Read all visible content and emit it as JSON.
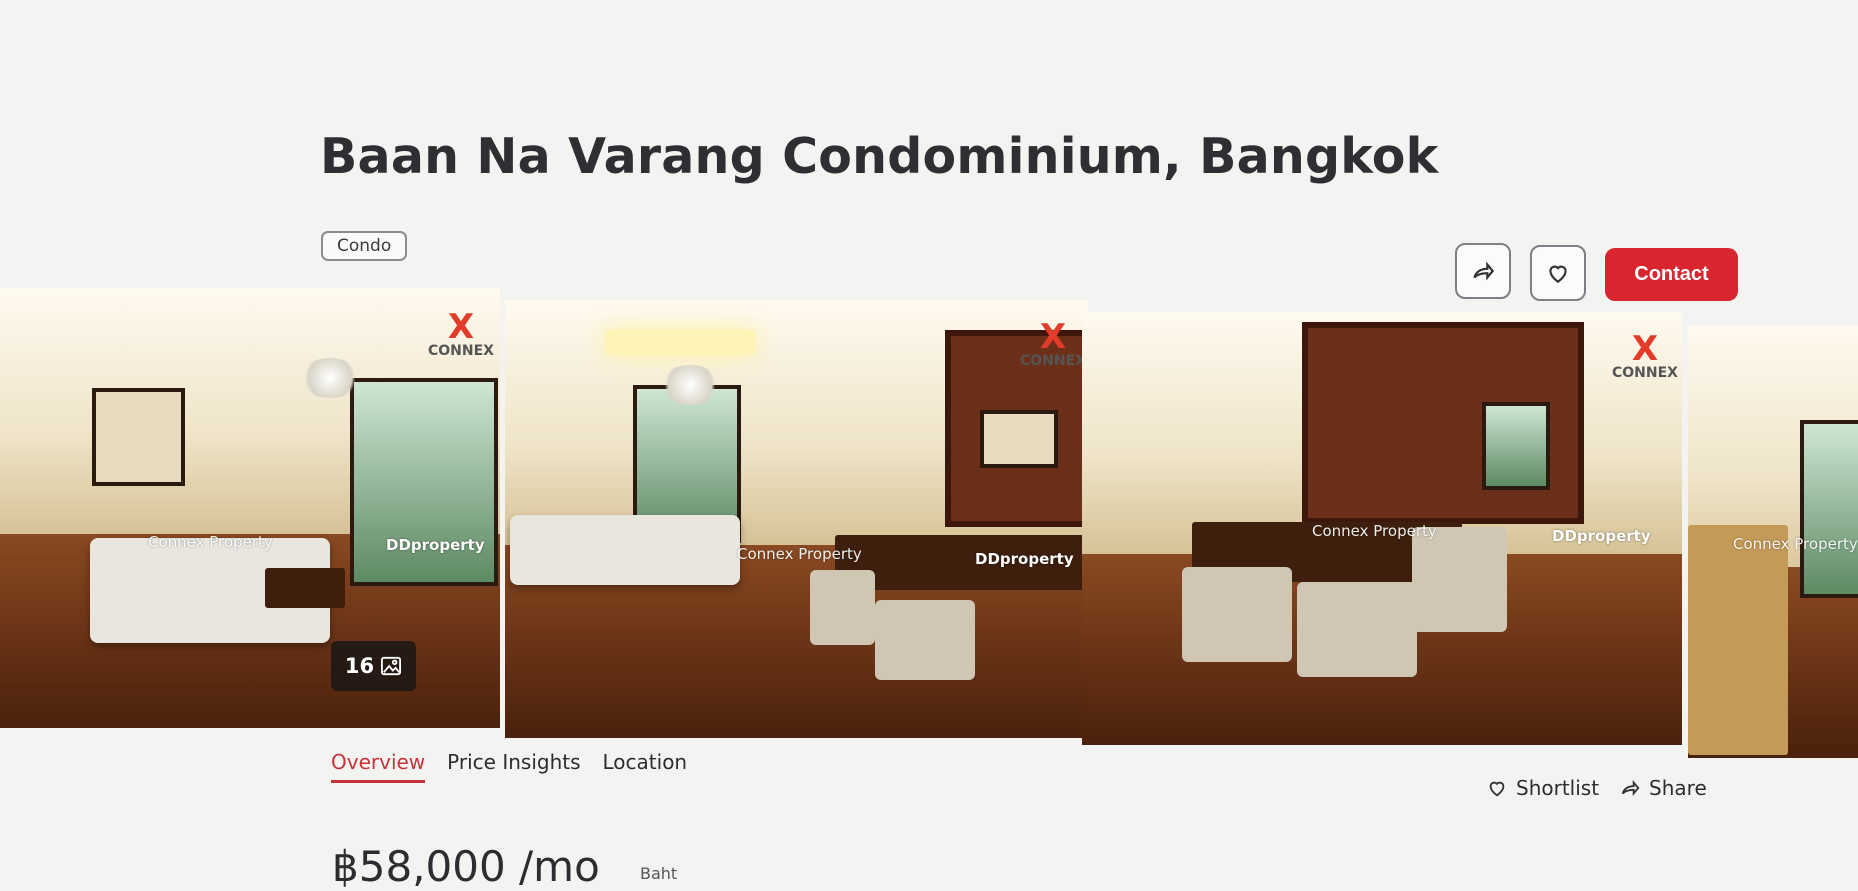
{
  "listing": {
    "title": "Baan Na Varang Condominium, Bangkok",
    "tag": "Condo"
  },
  "header_actions": {
    "share_icon": "share-arrow-icon",
    "favorite_icon": "heart-icon",
    "contact_label": "Contact",
    "accent_color": "#d9252e"
  },
  "gallery": {
    "photo_count": "16",
    "watermarks": {
      "agency": "Connex Property",
      "portal": "DDproperty",
      "logo_text": "CONNEX"
    }
  },
  "tabs": [
    {
      "label": "Overview",
      "active": true
    },
    {
      "label": "Price Insights",
      "active": false
    },
    {
      "label": "Location",
      "active": false
    }
  ],
  "page_actions": {
    "shortlist_label": "Shortlist",
    "share_label": "Share"
  },
  "pricing": {
    "price": "฿58,000 /mo",
    "currency_label": "Baht"
  }
}
